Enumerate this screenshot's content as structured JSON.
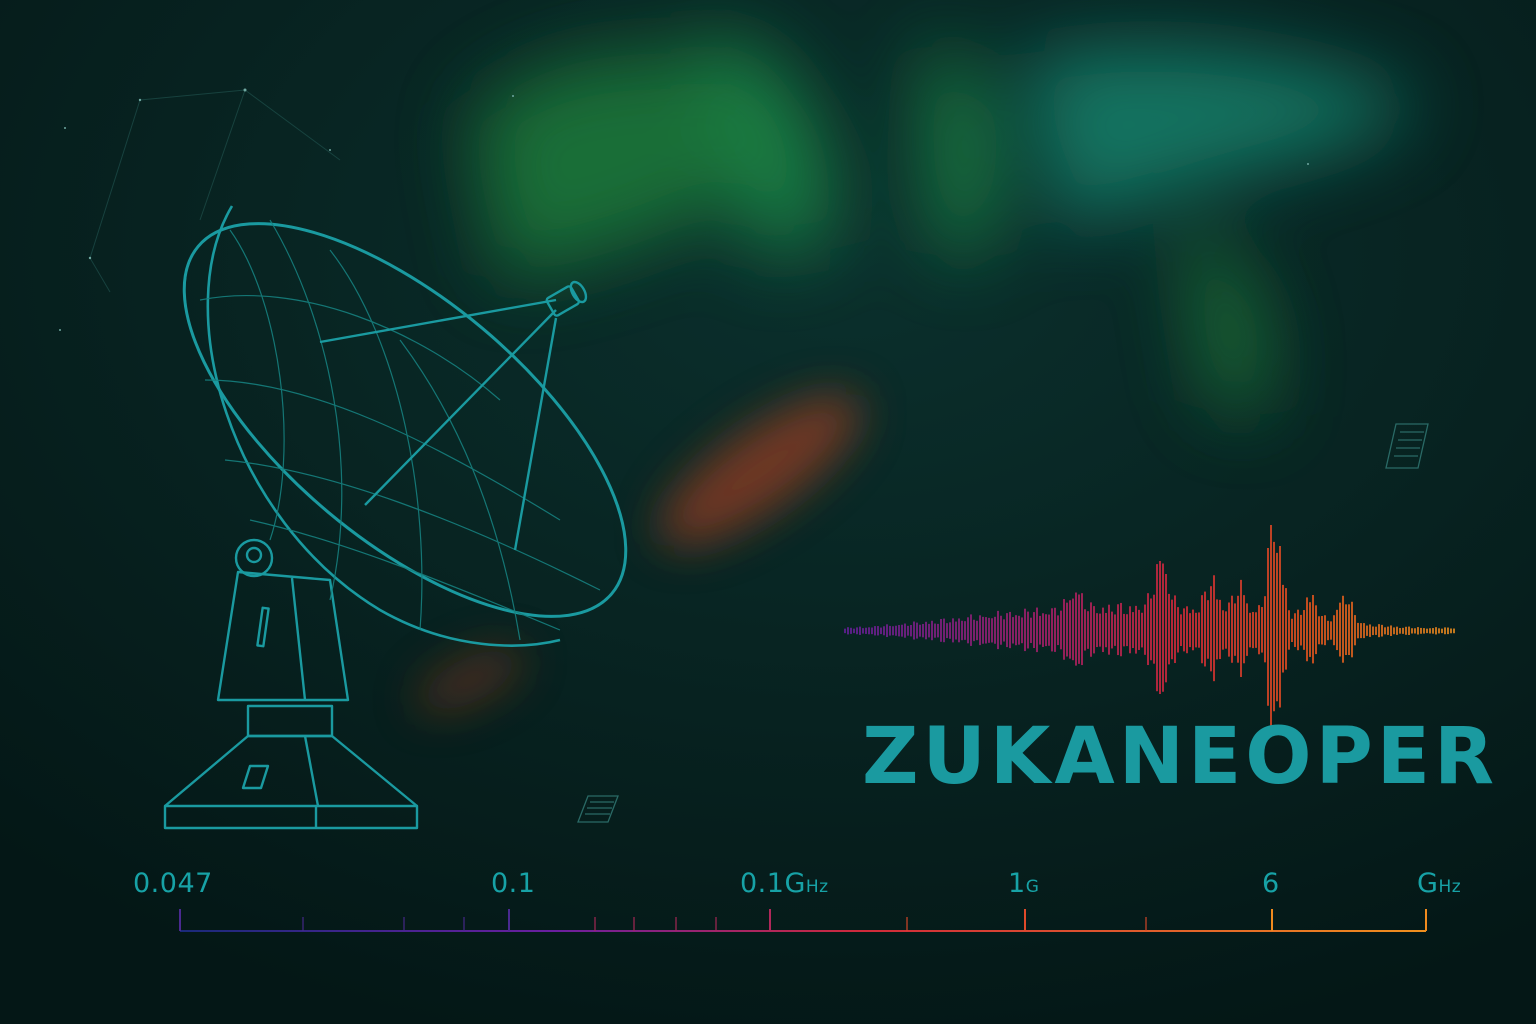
{
  "brand": {
    "title": "ZUKANEOPER"
  },
  "colors": {
    "background": "#06201f",
    "accent_teal": "#1a9aa0",
    "aurora_green": "#1f8f4a",
    "signal_start": "#6a1fa0",
    "signal_mid": "#e02a3a",
    "signal_end": "#f07a1e",
    "axis_start": "#1a2a7a"
  },
  "icons": [
    "radio-dish-icon",
    "aurora",
    "waveform",
    "frequency-axis"
  ],
  "frequency_axis": {
    "labels": [
      {
        "main": "0.047",
        "unit": ""
      },
      {
        "main": "0.1",
        "unit": ""
      },
      {
        "main": "0.1G",
        "unit": "Hz"
      },
      {
        "main": "1",
        "unit": "G"
      },
      {
        "main": "6",
        "unit": ""
      },
      {
        "main": "G",
        "unit": "Hz"
      }
    ]
  }
}
